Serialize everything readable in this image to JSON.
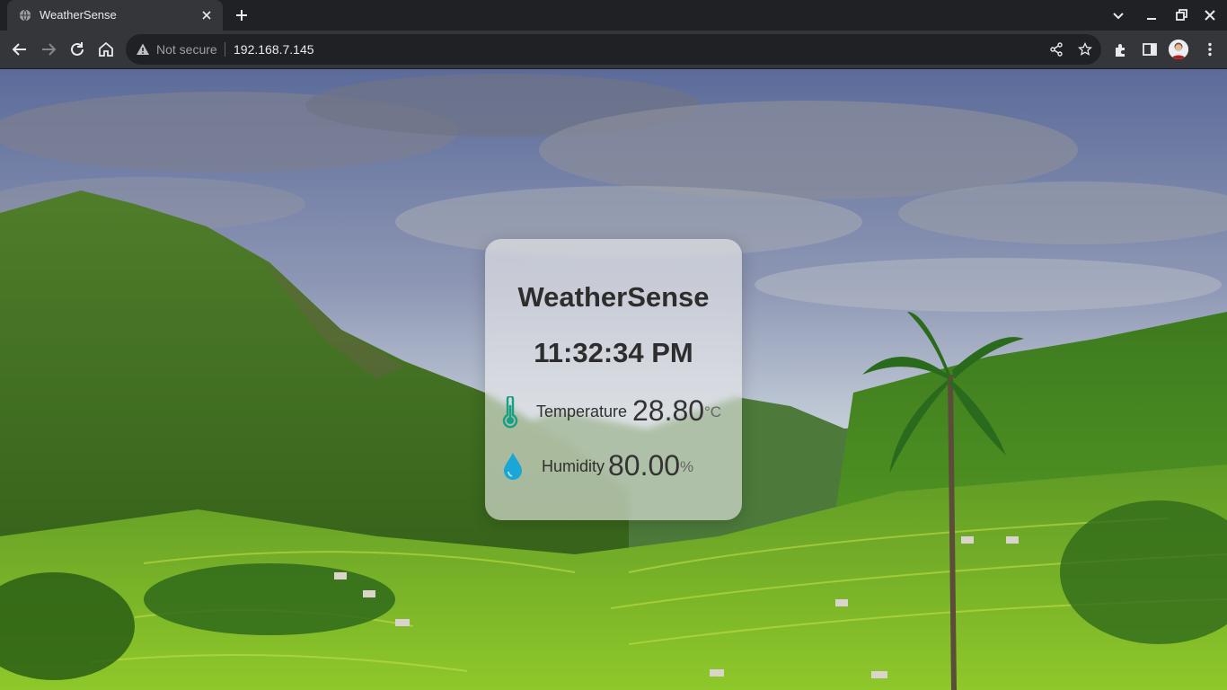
{
  "browser": {
    "tab_title": "WeatherSense",
    "security_label": "Not secure",
    "url": "192.168.7.145"
  },
  "weather_card": {
    "title": "WeatherSense",
    "time": "11:32:34 PM",
    "temperature": {
      "label": "Temperature",
      "value": "28.80",
      "unit": "°C",
      "icon": "thermometer-icon",
      "icon_color": "#16a085"
    },
    "humidity": {
      "label": "Humidity",
      "value": "80.00",
      "unit": "%",
      "icon": "water-drop-icon",
      "icon_color": "#1aa7d8"
    }
  },
  "colors": {
    "tab_bar": "#202124",
    "toolbar": "#35363a",
    "card_background": "#ebebeb",
    "text_dark": "#2d2d2d"
  }
}
